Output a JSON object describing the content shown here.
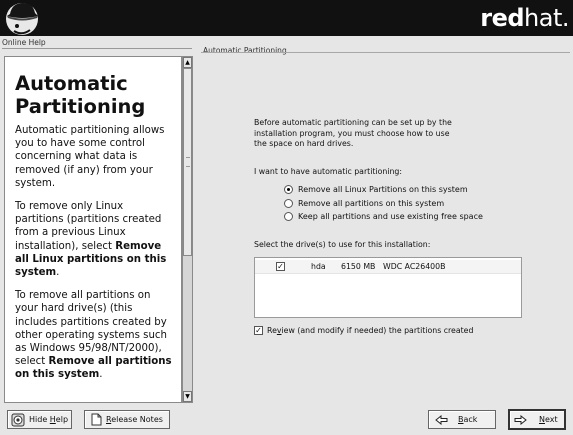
{
  "header": {
    "brand_bold": "red",
    "brand_rest": "hat.",
    "colors": {
      "background": "#111111",
      "brand_text": "#ffffff"
    }
  },
  "help": {
    "group_label": "Online Help",
    "title_line1": "Automatic",
    "title_line2": "Partitioning",
    "p1": "Automatic partitioning allows you to have some control concerning what data is removed (if any) from your system.",
    "p2_pre": "To remove only Linux partitions (partitions created from a previous Linux installation), select ",
    "p2_bold": "Remove all Linux partitions on this system",
    "p2_post": ".",
    "p3_pre": "To remove all partitions on your hard drive(s) (this includes partitions created by other operating systems such as Windows 95/98/NT/2000), select ",
    "p3_bold": "Remove all partitions on this system",
    "p3_post": ".",
    "scroll_up_icon": "arrow-up-icon",
    "scroll_down_icon": "arrow-down-icon"
  },
  "main": {
    "group_label": "Automatic Partitioning",
    "intro_line1": "Before automatic partitioning can be set up by the",
    "intro_line2": "installation program, you must choose how to use",
    "intro_line3": "the space on hard drives.",
    "want_label": "I want to have automatic partitioning:",
    "options": [
      {
        "label": "Remove all Linux Partitions on this system",
        "selected": true
      },
      {
        "label": "Remove all partitions on this system",
        "selected": false
      },
      {
        "label": "Keep all partitions and use existing free space",
        "selected": false
      }
    ],
    "drive_label": "Select the drive(s) to use for this installation:",
    "drives": [
      {
        "checked": true,
        "name": "hda",
        "size": "6150 MB",
        "model": "WDC AC26400B"
      }
    ],
    "review_pre": "Re",
    "review_ul": "v",
    "review_post": "iew (and modify if needed) the partitions created",
    "review_checked": true
  },
  "footer": {
    "hide_help_pre": "Hide ",
    "hide_help_ul": "H",
    "hide_help_post": "elp",
    "hide_help_icon": "help-toggle-icon",
    "release_notes_pre": "",
    "release_notes_ul": "R",
    "release_notes_post": "elease Notes",
    "release_notes_icon": "document-icon",
    "back_ul": "B",
    "back_post": "ack",
    "back_icon": "left-arrow-icon",
    "next_ul": "N",
    "next_post": "ext",
    "next_icon": "right-arrow-icon"
  }
}
